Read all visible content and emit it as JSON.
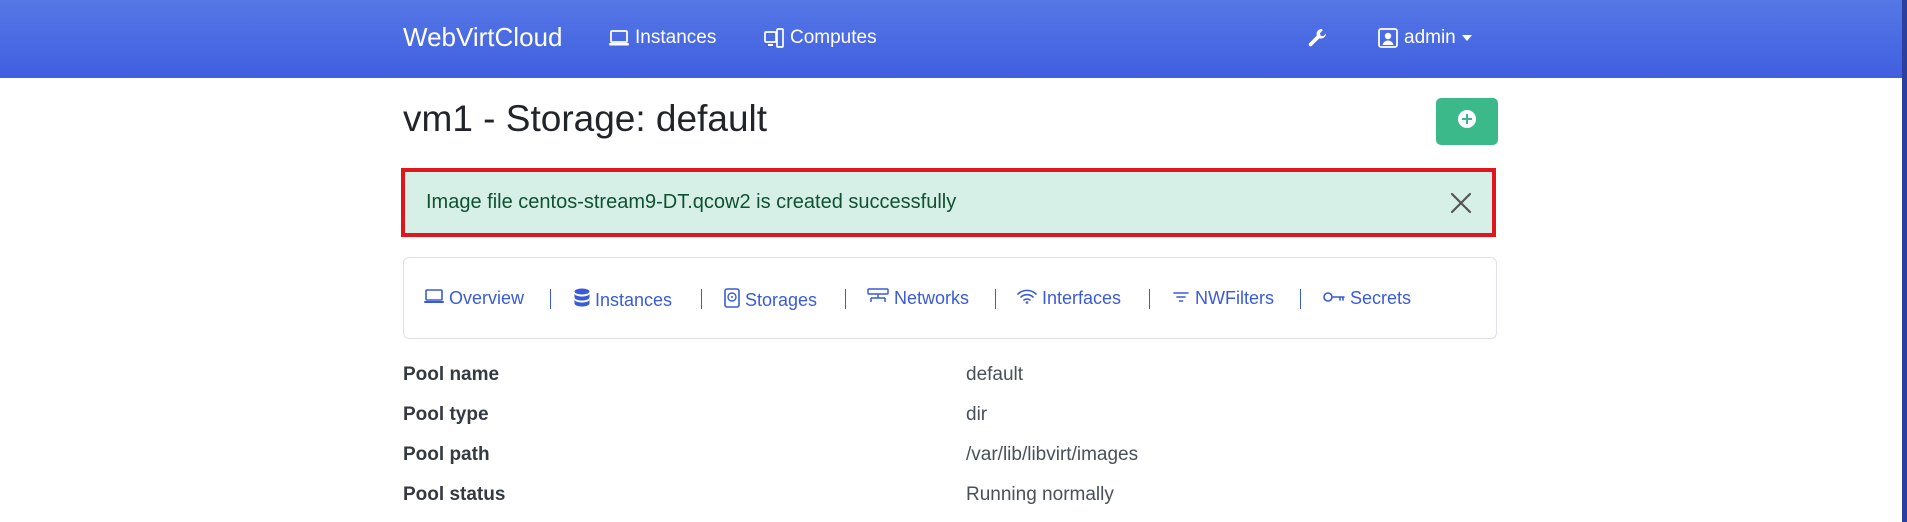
{
  "navbar": {
    "brand": "WebVirtCloud",
    "links": [
      {
        "label": "Instances",
        "icon": "laptop-icon"
      },
      {
        "label": "Computes",
        "icon": "computes-icon"
      }
    ],
    "settings_icon": "wrench-icon",
    "user": {
      "label": "admin",
      "icon": "user-icon"
    }
  },
  "page": {
    "title": "vm1 - Storage: default",
    "add_button_icon": "plus-circle-icon"
  },
  "alert": {
    "message": "Image file centos-stream9-DT.qcow2 is created successfully",
    "close_icon": "close-icon"
  },
  "tabs": [
    {
      "label": "Overview",
      "icon": "laptop-icon"
    },
    {
      "label": "Instances",
      "icon": "database-icon"
    },
    {
      "label": "Storages",
      "icon": "hdd-icon"
    },
    {
      "label": "Networks",
      "icon": "network-icon"
    },
    {
      "label": "Interfaces",
      "icon": "wifi-icon"
    },
    {
      "label": "NWFilters",
      "icon": "filter-icon"
    },
    {
      "label": "Secrets",
      "icon": "key-icon"
    }
  ],
  "details": [
    {
      "label": "Pool name",
      "value": "default"
    },
    {
      "label": "Pool type",
      "value": "dir"
    },
    {
      "label": "Pool path",
      "value": "/var/lib/libvirt/images"
    },
    {
      "label": "Pool status",
      "value": "Running normally"
    }
  ],
  "colors": {
    "navbar": "#4a6be4",
    "link": "#3a5bd9",
    "success": "#3cb98a",
    "alert_bg": "#d6f0e7",
    "alert_border": "#e0161d"
  }
}
